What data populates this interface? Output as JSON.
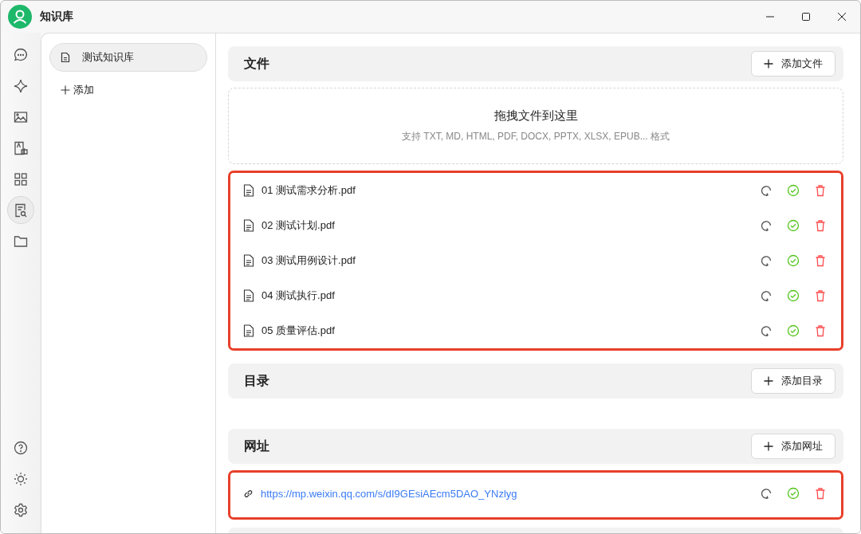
{
  "window": {
    "title": "知识库"
  },
  "rail": {
    "items": [
      {
        "kind": "chat",
        "selected": false
      },
      {
        "kind": "sparkle",
        "selected": false
      },
      {
        "kind": "image",
        "selected": false
      },
      {
        "kind": "translate",
        "selected": false
      },
      {
        "kind": "apps",
        "selected": false
      },
      {
        "kind": "knowledge",
        "selected": true
      },
      {
        "kind": "folder",
        "selected": false
      }
    ],
    "bottom": [
      {
        "kind": "help"
      },
      {
        "kind": "theme"
      },
      {
        "kind": "settings"
      }
    ]
  },
  "knowledge_bases": [
    {
      "name": "测试知识库",
      "selected": true
    }
  ],
  "add_label": "添加",
  "sections": [
    {
      "kind": "files",
      "title": "文件",
      "button": "添加文件",
      "dropzone": {
        "title": "拖拽文件到这里",
        "hint": "支持 TXT, MD, HTML, PDF, DOCX, PPTX, XLSX, EPUB... 格式"
      },
      "items": [
        {
          "name": "01 测试需求分析.pdf",
          "processed": true
        },
        {
          "name": "02 测试计划.pdf",
          "processed": true
        },
        {
          "name": "03 测试用例设计.pdf",
          "processed": true
        },
        {
          "name": "04 测试执行.pdf",
          "processed": true
        },
        {
          "name": "05 质量评估.pdf",
          "processed": true
        }
      ]
    },
    {
      "kind": "directories",
      "title": "目录",
      "button": "添加目录"
    },
    {
      "kind": "urls",
      "title": "网址",
      "button": "添加网址",
      "items": [
        {
          "name": "https://mp.weixin.qq.com/s/dI9GEsiAEcm5DAO_YNzlyg",
          "processed": true
        }
      ]
    }
  ]
}
